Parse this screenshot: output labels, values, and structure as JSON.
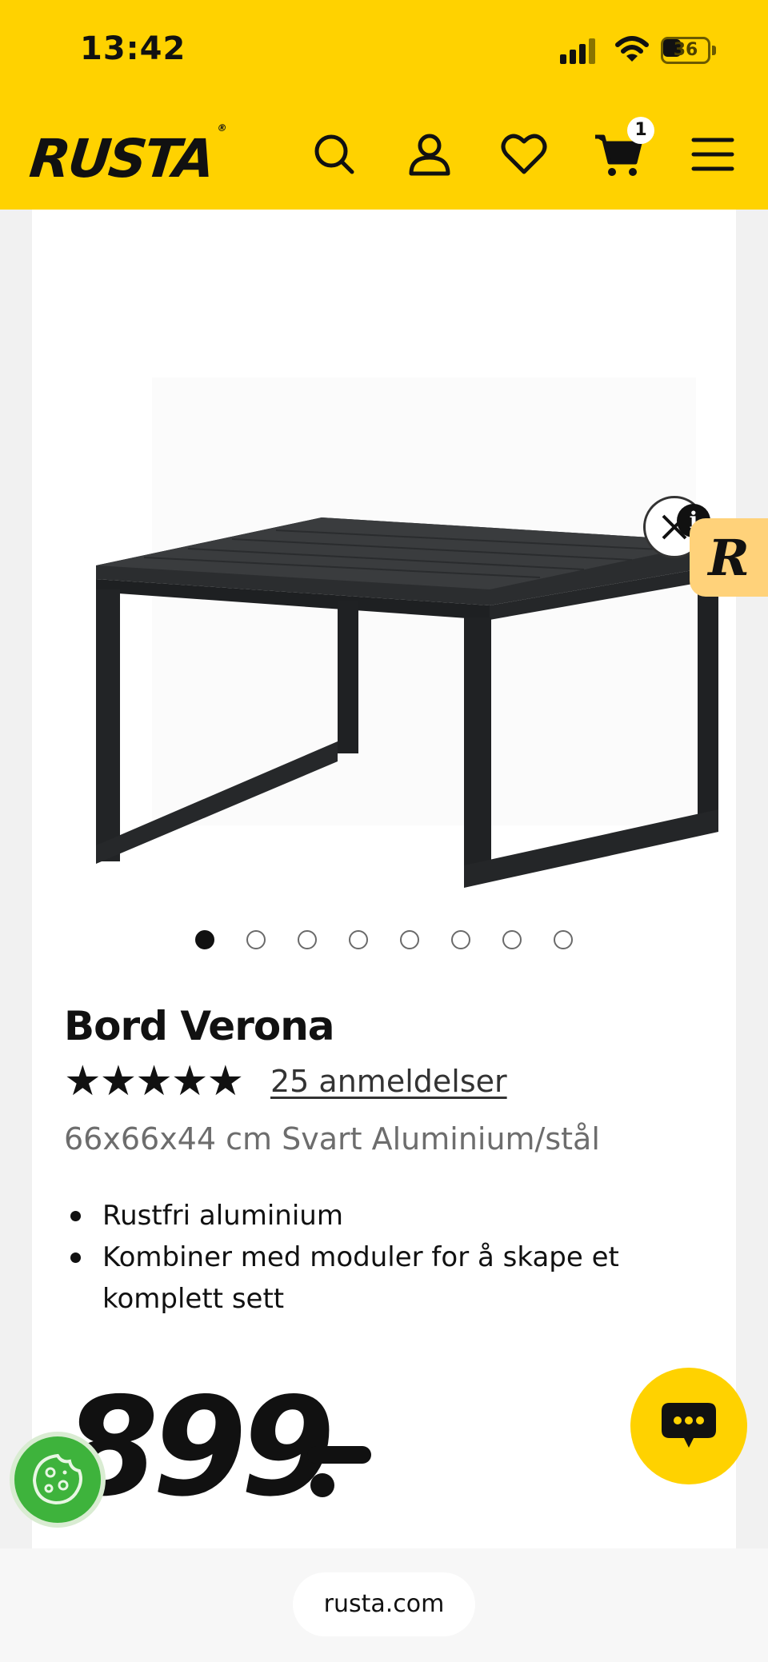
{
  "status_bar": {
    "time": "13:42",
    "battery": "36"
  },
  "header": {
    "logo": "RUSTA",
    "logo_mark": "®",
    "cart_count": "1",
    "icons": [
      "search-icon",
      "account-icon",
      "heart-icon",
      "cart-icon",
      "menu-icon"
    ]
  },
  "product": {
    "title": "Bord Verona",
    "rating_stars": "★★★★★",
    "rating": 5,
    "reviews_link": "25 anmeldelser",
    "subtitle": "66x66x44 cm Svart Aluminium/stål",
    "bullets": [
      "Rustfri aluminium",
      "Kombiner med moduler for å skape et komplett sett"
    ],
    "price": "899",
    "image_count": 8,
    "active_image": 1
  },
  "widgets": {
    "info_badge": "i",
    "r_badge": "R"
  },
  "browser": {
    "url": "rusta.com"
  },
  "colors": {
    "brand_yellow": "#ffd200",
    "cookie_green": "#3eb33c",
    "r_tab": "#ffd27a"
  }
}
